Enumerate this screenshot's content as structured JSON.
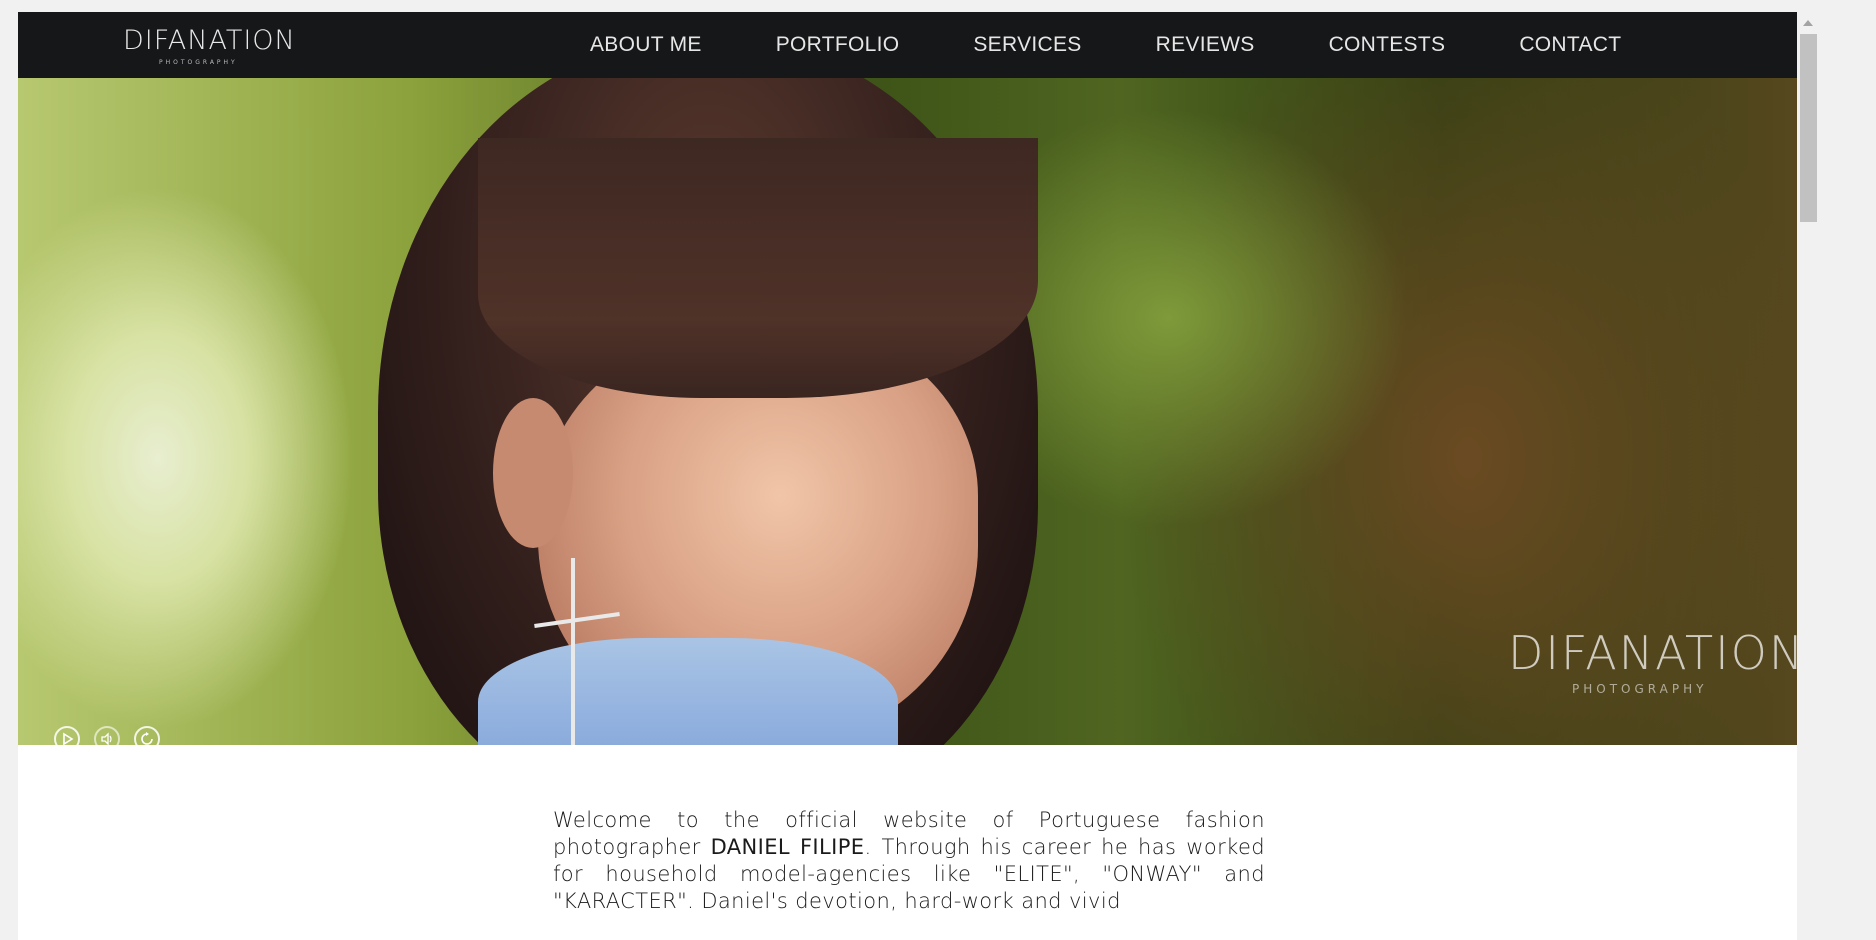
{
  "brand": {
    "name": "DIFANATION",
    "tagline": "PHOTOGRAPHY"
  },
  "nav": {
    "items": [
      "ABOUT ME",
      "PORTFOLIO",
      "SERVICES",
      "REVIEWS",
      "CONTESTS",
      "CONTACT"
    ]
  },
  "hero": {
    "watermark_name": "DIFANATION",
    "watermark_tagline": "PHOTOGRAPHY",
    "controls": [
      "play-icon",
      "volume-icon",
      "replay-icon"
    ]
  },
  "intro": {
    "before_name": "Welcome to the official website of Portuguese fashion photographer ",
    "name": "DANIEL FILIPE",
    "after_name": ". Through his career he has worked for household model-agencies like \"ELITE\", \"ONWAY\" and \"KARACTER\". Daniel's devotion, hard-work and vivid"
  }
}
